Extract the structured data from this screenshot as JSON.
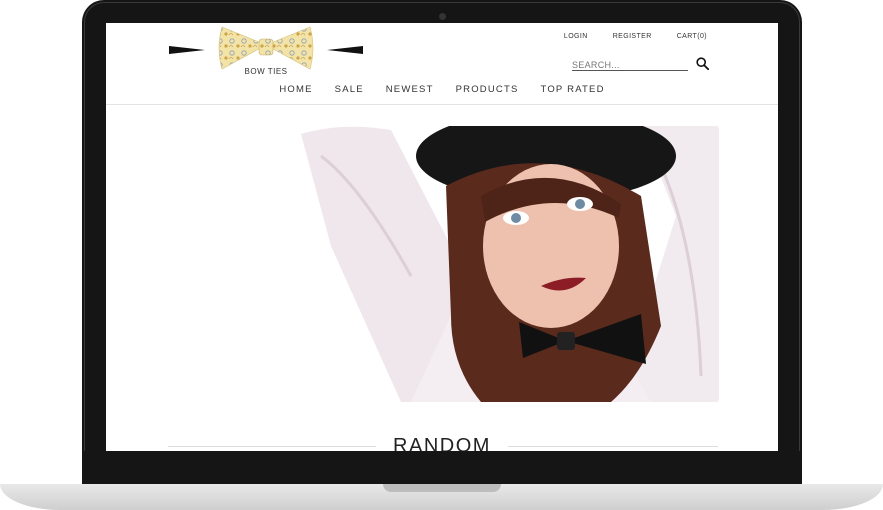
{
  "brand": {
    "name": "BOW TIES",
    "pattern_color": "#e9d48a",
    "wing_color": "#111111"
  },
  "toplinks": {
    "login": "LOGIN",
    "register": "REGISTER",
    "cart": "CART(0)"
  },
  "search": {
    "placeholder": "SEARCH..."
  },
  "nav": {
    "items": [
      "HOME",
      "SALE",
      "NEWEST",
      "PRODUCTS",
      "TOP RATED"
    ]
  },
  "hero": {
    "image": "woman-in-white-shirt-and-black-bow-tie-photo"
  },
  "section": {
    "title": "RANDOM"
  },
  "icons": {
    "search": "search-icon",
    "camera": "camera-dot"
  }
}
